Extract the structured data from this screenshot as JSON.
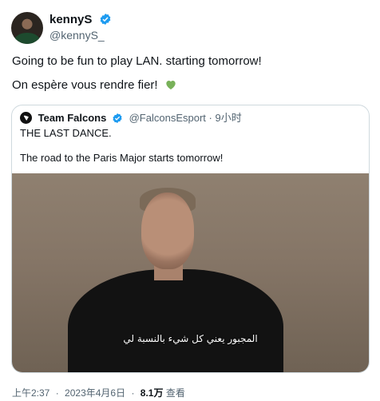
{
  "author": {
    "name": "kennyS",
    "handle": "@kennyS_",
    "verified": true
  },
  "tweet": {
    "line1": "Going to be fun to play LAN. starting tomorrow!",
    "line2": "On espère vous rendre fier!",
    "emoji": "green-heart"
  },
  "quoted": {
    "name": "Team Falcons",
    "handle": "@FalconsEsport",
    "separator": "·",
    "time": "9小时",
    "line1": "THE LAST DANCE.",
    "line2": "The road to the Paris Major starts tomorrow!",
    "video_subtitle": "المجبور يعني كل شيء بالنسبة لي"
  },
  "footer": {
    "time": "上午2:37",
    "date": "2023年4月6日",
    "views": "8.1万",
    "views_label": "查看"
  },
  "colors": {
    "verified_blue": "#1d9bf0",
    "secondary_text": "#536471",
    "heart_green": "#78b159"
  }
}
